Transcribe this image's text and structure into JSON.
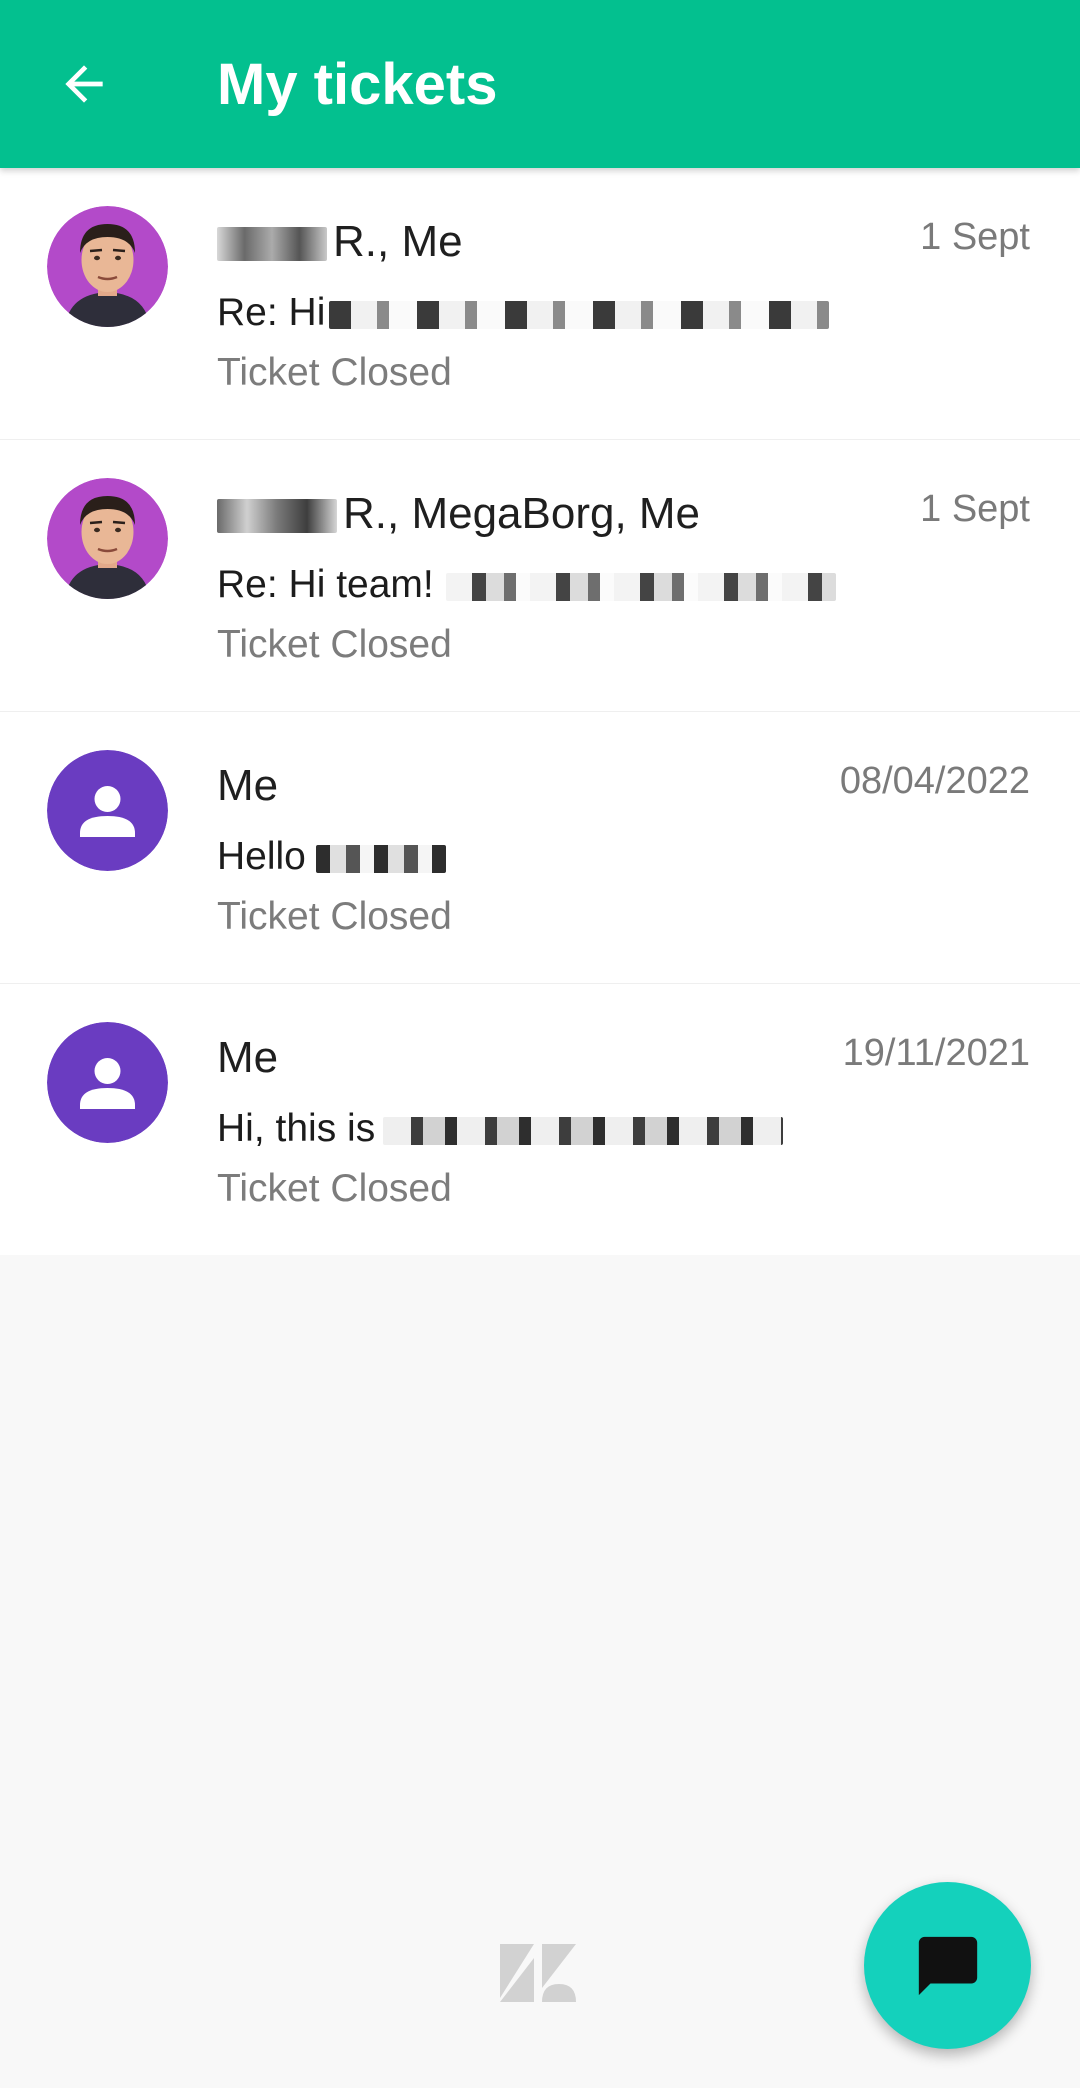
{
  "header": {
    "title": "My tickets",
    "back_icon": "arrow-left-icon"
  },
  "colors": {
    "app_bar": "#03c08f",
    "fab": "#14d1bc",
    "avatar_purple": "#6a3cc1",
    "photo_ring": "#b34ac9"
  },
  "tickets": [
    {
      "participants": "R., Me",
      "date": "1 Sept",
      "preview": "Re: Hi",
      "status": "Ticket Closed",
      "avatar": "photo-avatar"
    },
    {
      "participants": "R., MegaBorg, Me",
      "date": "1 Sept",
      "preview": "Re: Hi team!",
      "status": "Ticket Closed",
      "avatar": "photo-avatar"
    },
    {
      "participants": "Me",
      "date": "08/04/2022",
      "preview": "Hello",
      "status": "Ticket Closed",
      "avatar": "person-icon"
    },
    {
      "participants": "Me",
      "date": "19/11/2021",
      "preview": "Hi, this is",
      "status": "Ticket Closed",
      "avatar": "person-icon"
    }
  ],
  "footer": {
    "logo": "zendesk-logo"
  },
  "fab": {
    "icon": "chat-bubble-icon"
  }
}
